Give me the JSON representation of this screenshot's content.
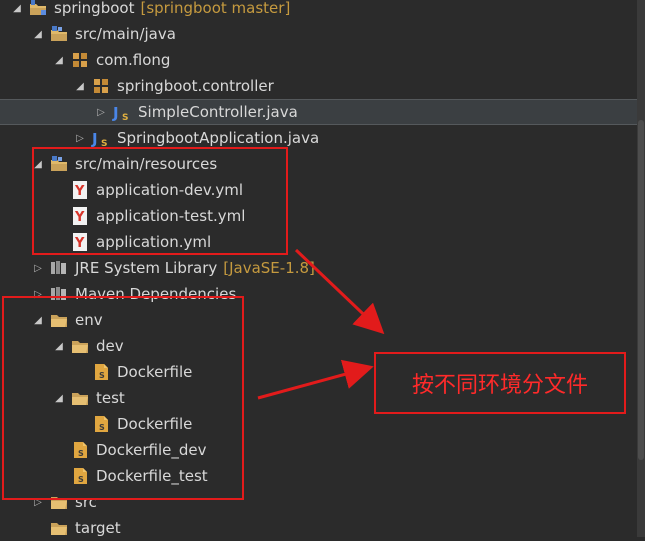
{
  "tree": {
    "rows": [
      {
        "indent": 0,
        "toggle": "open",
        "icon": "project",
        "label": "springboot",
        "decoration": "[springboot master]"
      },
      {
        "indent": 1,
        "toggle": "open",
        "icon": "source-folder",
        "label": "src/main/java"
      },
      {
        "indent": 2,
        "toggle": "open",
        "icon": "package",
        "label": "com.flong"
      },
      {
        "indent": 3,
        "toggle": "open",
        "icon": "package",
        "label": "springboot.controller"
      },
      {
        "indent": 4,
        "toggle": "closed",
        "icon": "java",
        "label": "SimpleController.java",
        "selected": true
      },
      {
        "indent": 3,
        "toggle": "closed",
        "icon": "java",
        "label": "SpringbootApplication.java"
      },
      {
        "indent": 1,
        "toggle": "open",
        "icon": "source-folder",
        "label": "src/main/resources"
      },
      {
        "indent": 2,
        "toggle": "none",
        "icon": "yaml",
        "label": "application-dev.yml"
      },
      {
        "indent": 2,
        "toggle": "none",
        "icon": "yaml",
        "label": "application-test.yml"
      },
      {
        "indent": 2,
        "toggle": "none",
        "icon": "yaml",
        "label": "application.yml"
      },
      {
        "indent": 1,
        "toggle": "closed",
        "icon": "library",
        "label": "JRE System Library",
        "decoration": "[JavaSE-1.8]"
      },
      {
        "indent": 1,
        "toggle": "closed",
        "icon": "library",
        "label": "Maven Dependencies"
      },
      {
        "indent": 1,
        "toggle": "open",
        "icon": "folder",
        "label": "env"
      },
      {
        "indent": 2,
        "toggle": "open",
        "icon": "folder",
        "label": "dev"
      },
      {
        "indent": 3,
        "toggle": "none",
        "icon": "docker-file",
        "label": "Dockerfile"
      },
      {
        "indent": 2,
        "toggle": "open",
        "icon": "folder",
        "label": "test"
      },
      {
        "indent": 3,
        "toggle": "none",
        "icon": "docker-file",
        "label": "Dockerfile"
      },
      {
        "indent": 2,
        "toggle": "none",
        "icon": "docker-file",
        "label": "Dockerfile_dev"
      },
      {
        "indent": 2,
        "toggle": "none",
        "icon": "docker-file",
        "label": "Dockerfile_test"
      },
      {
        "indent": 1,
        "toggle": "closed",
        "icon": "folder",
        "label": "src"
      },
      {
        "indent": 1,
        "toggle": "none",
        "icon": "folder",
        "label": "target"
      }
    ]
  },
  "annotation": {
    "callout_text": "按不同环境分文件"
  },
  "colors": {
    "background": "#2b2b2b",
    "selection": "#3b3f42",
    "annotation_red": "#e21b1b",
    "decoration": "#c59a3f"
  }
}
